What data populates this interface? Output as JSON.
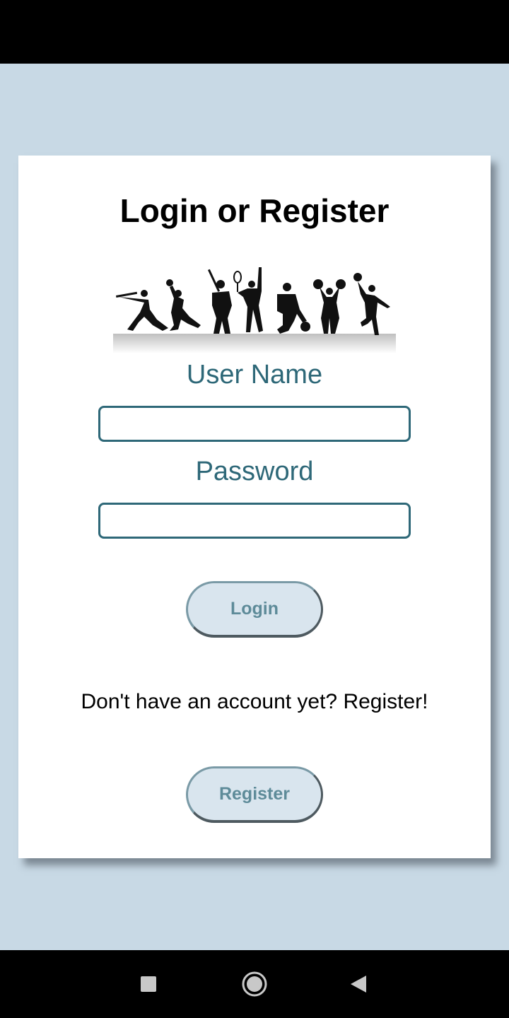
{
  "login": {
    "title": "Login or Register",
    "username_label": "User Name",
    "username_value": "",
    "password_label": "Password",
    "password_value": "",
    "login_button": "Login",
    "register_prompt": "Don't have an account yet? Register!",
    "register_button": "Register"
  },
  "colors": {
    "background": "#c8d9e5",
    "card": "#ffffff",
    "label_teal": "#2e6878",
    "button_fill": "#d9e5ee",
    "button_text": "#5e8b99"
  },
  "illustration": {
    "icon": "sports-silhouettes-icon"
  },
  "nav": {
    "recent_icon": "square-recent-apps-icon",
    "home_icon": "circle-home-icon",
    "back_icon": "triangle-back-icon"
  }
}
